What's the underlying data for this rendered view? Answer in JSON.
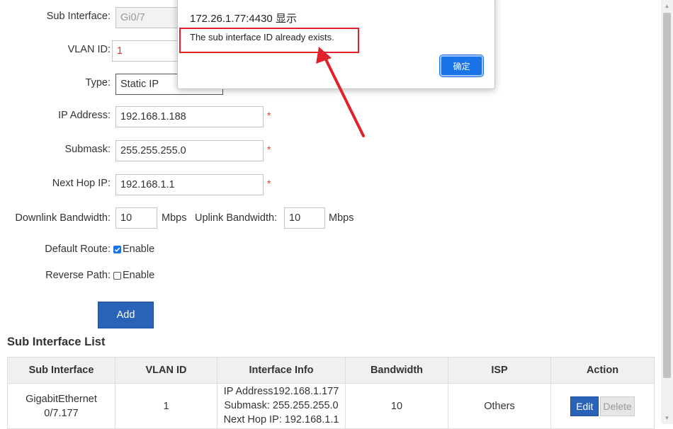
{
  "form": {
    "sub_interface_label": "Sub Interface:",
    "sub_interface_value": "Gi0/7",
    "vlan_label": "VLAN ID:",
    "vlan_value": "1",
    "type_label": "Type:",
    "type_value": "Static IP",
    "ip_label": "IP Address:",
    "ip_value": "192.168.1.188",
    "mask_label": "Submask:",
    "mask_value": "255.255.255.0",
    "nexthop_label": "Next Hop IP:",
    "nexthop_value": "192.168.1.1",
    "required_mark": "*",
    "downlink_label": "Downlink Bandwidth:",
    "downlink_value": "10",
    "uplink_label": "Uplink Bandwidth:",
    "uplink_value": "10",
    "unit": "Mbps",
    "default_route_label": "Default Route:",
    "reverse_path_label": "Reverse Path:",
    "enable_label": "Enable",
    "default_route_checked": true,
    "reverse_path_checked": false,
    "add_button": "Add"
  },
  "list": {
    "title": "Sub Interface List",
    "columns": [
      "Sub Interface",
      "VLAN ID",
      "Interface Info",
      "Bandwidth",
      "ISP",
      "Action"
    ],
    "rows": [
      {
        "sub_interface_line1": "GigabitEthernet",
        "sub_interface_line2": "0/7.177",
        "vlan_id": "1",
        "info_ip": "IP Address192.168.1.177",
        "info_mask": "Submask: 255.255.255.0",
        "info_nexthop": "Next Hop IP: 192.168.1.1",
        "bandwidth": "10",
        "isp": "Others",
        "edit": "Edit",
        "delete": "Delete"
      }
    ]
  },
  "dialog": {
    "title": "172.26.1.77:4430 显示",
    "message": "The sub interface ID already exists.",
    "ok_button": "确定"
  },
  "colors": {
    "primary_button": "#2a62b8",
    "dialog_ok": "#1a73e8",
    "annotation_red": "#e0222a",
    "required_red": "#e53935"
  }
}
